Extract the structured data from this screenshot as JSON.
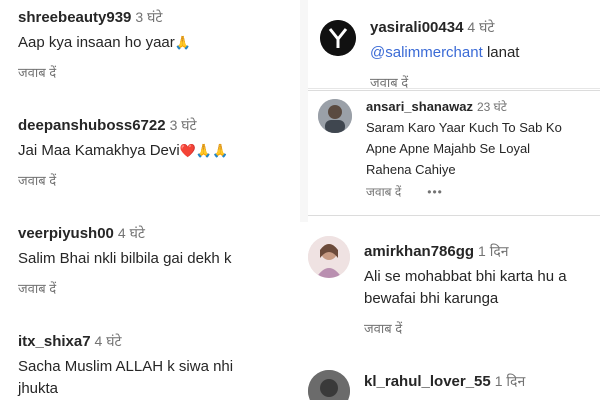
{
  "left": {
    "comments": [
      {
        "username": "shreebeauty939",
        "time": "3 घंटे",
        "text": "Aap kya insaan ho yaar",
        "emoji": "🙏",
        "reply": "जवाब दें"
      },
      {
        "username": "deepanshuboss6722",
        "time": "3 घंटे",
        "text": "Jai Maa Kamakhya Devi",
        "emoji": "❤️🙏🙏",
        "reply": "जवाब दें"
      },
      {
        "username": "veerpiyush00",
        "time": "4 घंटे",
        "text": "Salim Bhai nkli bilbila gai dekh k",
        "reply": "जवाब दें"
      },
      {
        "username": "itx_shixa7",
        "time": "4 घंटे",
        "text_line1": "Sacha Muslim ALLAH k siwa nhi",
        "text_line2": "jhukta"
      }
    ]
  },
  "right_top1": {
    "username": "yasirali00434",
    "time": "4 घंटे",
    "mention": "@salimmerchant",
    "text": "lanat",
    "reply": "जवाब दें"
  },
  "right_top2": {
    "username": "ansari_shanawaz",
    "time": "23 घंटे",
    "text_line1": "Saram Karo Yaar Kuch To Sab Ko",
    "text_line2": "Apne Apne Majahb Se Loyal",
    "text_line3": "Rahena Cahiye",
    "reply": "जवाब दें",
    "more": "•••"
  },
  "right_bottom": {
    "c1": {
      "username": "amirkhan786gg",
      "time": "1 दिन",
      "text_line1": "Ali se mohabbat bhi karta hu a",
      "text_line2": "bewafai bhi karunga",
      "reply": "जवाब दें"
    },
    "c2": {
      "username": "kl_rahul_lover_55",
      "time": "1 दिन"
    }
  }
}
